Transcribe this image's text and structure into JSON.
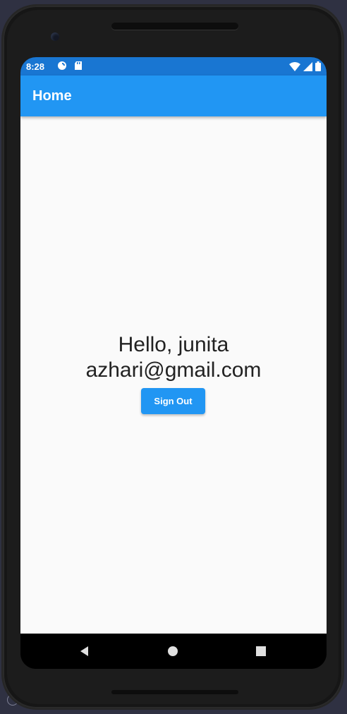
{
  "status_bar": {
    "time": "8:28",
    "icons": [
      "sync-icon",
      "sd-card-icon"
    ],
    "right_icons": [
      "wifi-icon",
      "signal-icon",
      "battery-icon"
    ],
    "color": "#1976d2"
  },
  "app_bar": {
    "title": "Home",
    "color": "#2196f3"
  },
  "main": {
    "greeting_line1": "Hello, junita",
    "greeting_line2": "azhari@gmail.com",
    "sign_out_label": "Sign Out"
  },
  "nav_bar": {
    "buttons": [
      "back-icon",
      "home-icon",
      "recents-icon"
    ]
  }
}
